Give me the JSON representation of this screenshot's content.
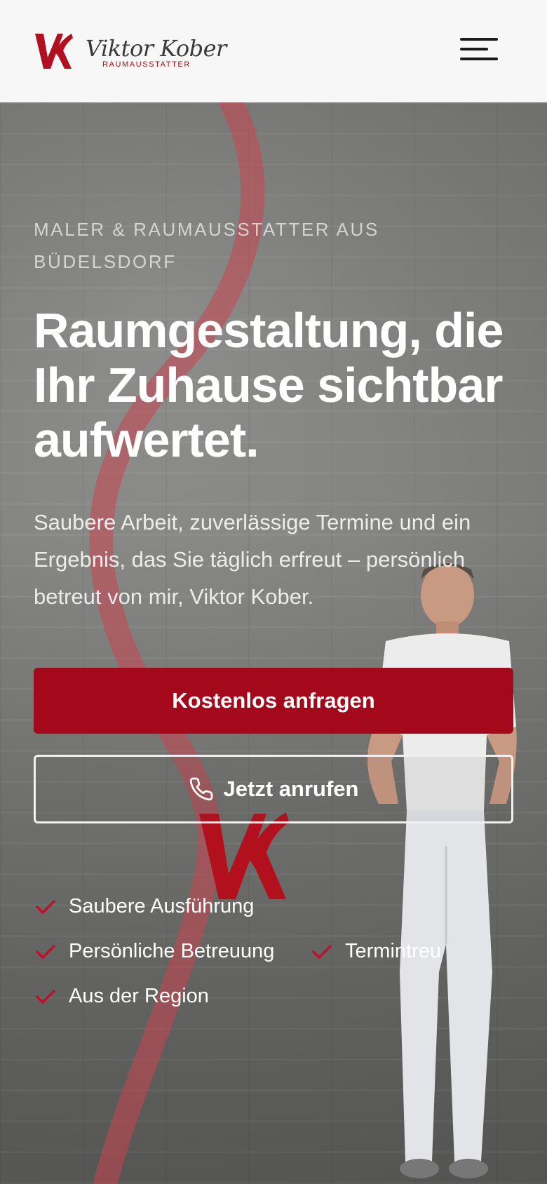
{
  "header": {
    "logo_name": "Viktor Kober",
    "logo_sub": "RAUMAUSSTATTER",
    "menu_icon": "hamburger-menu-icon"
  },
  "hero": {
    "eyebrow": "MALER & RAUMAUSSTATTER AUS BÜDELSDORF",
    "headline": "Raumgestaltung, die Ihr Zuhause sichtbar aufwertet.",
    "lead": "Saubere Arbeit, zuverlässige Termine und ein Ergebnis, das Sie täglich erfreut – persönlich betreut von mir, Viktor Kober.",
    "primary_cta": "Kostenlos anfragen",
    "secondary_cta": "Jetzt anrufen",
    "features": [
      "Saubere Ausführung",
      "Persönliche Betreuung",
      "Termintreu",
      "Aus der Region"
    ]
  },
  "colors": {
    "brand_red": "#a3091a",
    "header_bg": "#f7f7f7",
    "text_white": "#ffffff"
  }
}
